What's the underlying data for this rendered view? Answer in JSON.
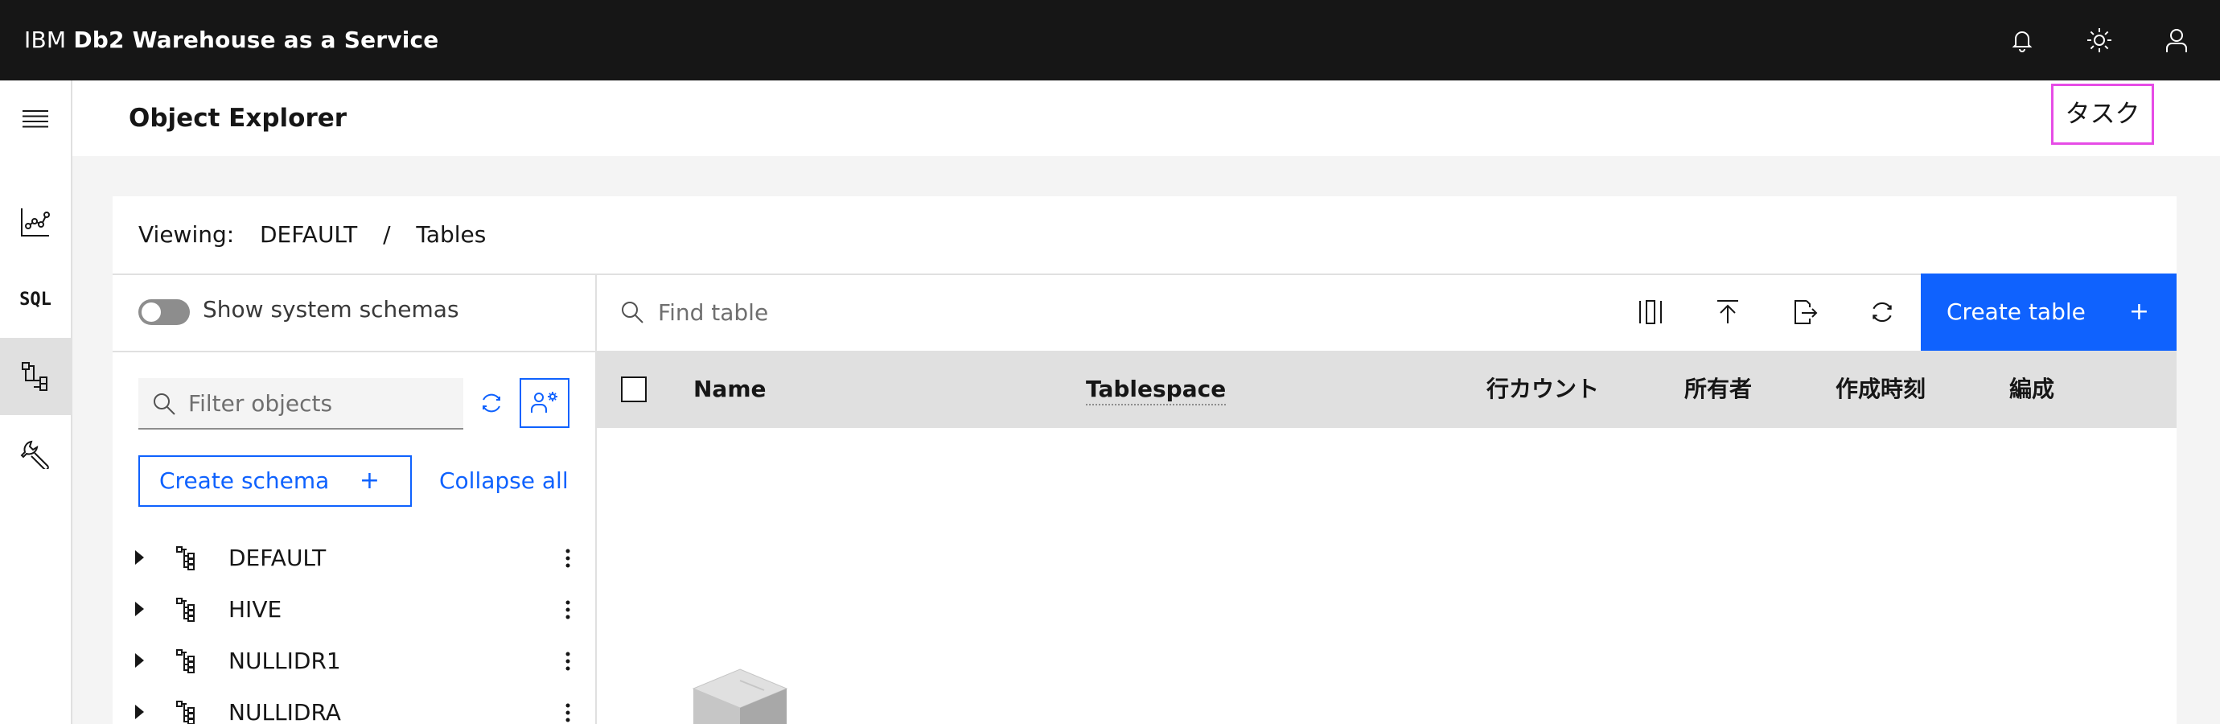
{
  "header": {
    "brand_prefix": "IBM",
    "brand_product": "Db2 Warehouse as a Service",
    "icons": [
      "notification-icon",
      "theme-icon",
      "user-icon"
    ]
  },
  "rail": {
    "items": [
      {
        "name": "menu",
        "icon": "menu-icon"
      },
      {
        "name": "monitor",
        "icon": "chart-line-icon"
      },
      {
        "name": "sql",
        "label": "SQL"
      },
      {
        "name": "data",
        "icon": "data-structured-icon",
        "active": true
      },
      {
        "name": "administration",
        "icon": "wrench-icon"
      }
    ]
  },
  "page": {
    "title": "Object Explorer",
    "task_button": "タスク"
  },
  "viewing": {
    "label": "Viewing:",
    "schema": "DEFAULT",
    "separator": "/",
    "object": "Tables"
  },
  "left_panel": {
    "toggle_label": "Show system schemas",
    "toggle_on": false,
    "filter_placeholder": "Filter objects",
    "create_schema": "Create schema",
    "create_schema_plus": "+",
    "collapse_all": "Collapse all",
    "schemas": [
      "DEFAULT",
      "HIVE",
      "NULLIDR1",
      "NULLIDRA"
    ]
  },
  "table_toolbar": {
    "search_placeholder": "Find table",
    "tools": [
      "columns-icon",
      "upload-icon",
      "export-icon",
      "refresh-icon"
    ],
    "create_table": "Create table",
    "create_table_plus": "+"
  },
  "table": {
    "columns": [
      "Name",
      "Tablespace",
      "行カウント",
      "所有者",
      "作成時刻",
      "編成"
    ]
  },
  "colors": {
    "primary": "#0f62fe",
    "header_bg": "#161616",
    "highlight": "#e64ce6"
  }
}
